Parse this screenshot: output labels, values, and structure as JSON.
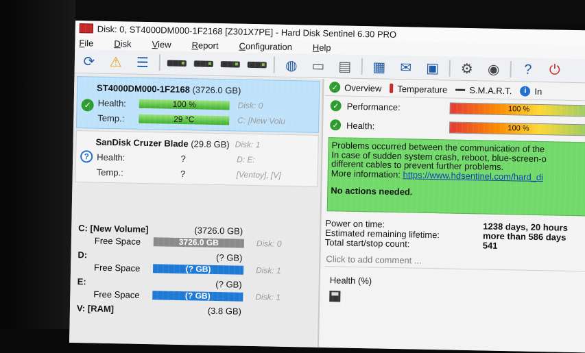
{
  "window": {
    "title": "Disk: 0, ST4000DM000-1F2168 [Z301X7PE]  -  Hard Disk Sentinel 6.30 PRO"
  },
  "menu": [
    "File",
    "Disk",
    "View",
    "Report",
    "Configuration",
    "Help"
  ],
  "disks": [
    {
      "name": "ST4000DM000-1F2168",
      "size": "(3726.0 GB)",
      "health_label": "Health:",
      "health_value": "100 %",
      "temp_label": "Temp.:",
      "temp_value": "29 °C",
      "ghost_health": "Disk: 0",
      "ghost_temp": "C: [New Volu",
      "status_icon": "check-icon"
    },
    {
      "name": "SanDisk Cruzer Blade",
      "size": "(29.8 GB)",
      "ghost_name": "Disk: 1",
      "health_label": "Health:",
      "health_value": "?",
      "temp_label": "Temp.:",
      "temp_value": "?",
      "ghost_health": "D:  E:",
      "ghost_temp": "[Ventoy],  [V]",
      "status_icon": "question-icon"
    }
  ],
  "volumes": [
    {
      "name": "C: [New Volume]",
      "size": "(3726.0 GB)",
      "free_label": "Free Space",
      "free_value": "3726.0 GB",
      "ghost": "Disk: 0",
      "bar": "gray"
    },
    {
      "name": "D:",
      "size": "(? GB)",
      "free_label": "Free Space",
      "free_value": "(? GB)",
      "ghost": "Disk: 1",
      "bar": "blue"
    },
    {
      "name": "E:",
      "size": "(? GB)",
      "free_label": "Free Space",
      "free_value": "(? GB)",
      "ghost": "Disk: 1",
      "bar": "blue"
    },
    {
      "name": "V: [RAM]",
      "size": "(3.8 GB)"
    }
  ],
  "tabs": [
    "Overview",
    "Temperature",
    "S.M.A.R.T.",
    "In"
  ],
  "performance": {
    "label": "Performance:",
    "value": "100 %",
    "fraction": 1.0
  },
  "health": {
    "label": "Health:",
    "value": "100 %",
    "fraction": 1.0
  },
  "message": {
    "line1": "Problems occurred between the communication of the",
    "line2": "In case of sudden system crash, reboot, blue-screen-o",
    "line3": "different cables to prevent further problems.",
    "more_label": "More information:",
    "link": "https://www.hdsentinel.com/hard_di",
    "action": "No actions needed."
  },
  "stats": [
    {
      "label": "Power on time:",
      "value": "1238 days, 20 hours"
    },
    {
      "label": "Estimated remaining lifetime:",
      "value": "more than 586 days"
    },
    {
      "label": "Total start/stop count:",
      "value": "541"
    }
  ],
  "comment_placeholder": "Click to add comment ...",
  "health_chart_title": "Health (%)",
  "colors": {
    "selected": "#bfe2fb",
    "ok": "#2e9b2e",
    "message_bg": "#72da6a",
    "accent": "#1f7ad6"
  }
}
